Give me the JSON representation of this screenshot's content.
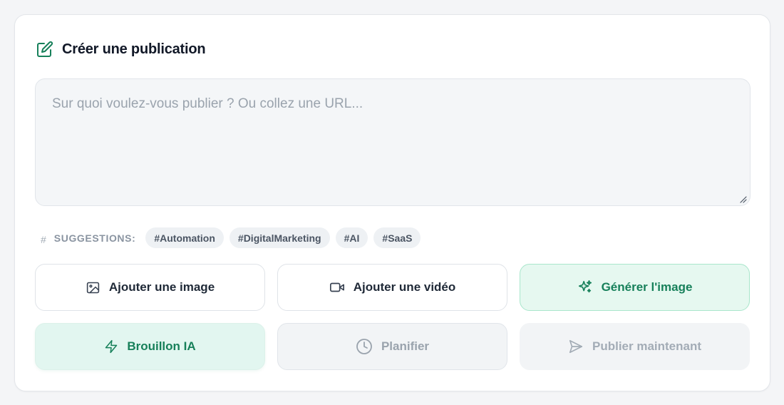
{
  "header": {
    "title": "Créer une publication",
    "icon": "edit-icon"
  },
  "composer": {
    "placeholder": "Sur quoi voulez-vous publier ? Ou collez une URL...",
    "value": ""
  },
  "suggestions": {
    "label": "SUGGESTIONS:",
    "tags": [
      "#Automation",
      "#DigitalMarketing",
      "#AI",
      "#SaaS"
    ]
  },
  "actions": {
    "add_image": {
      "label": "Ajouter une image",
      "icon": "image-icon"
    },
    "add_video": {
      "label": "Ajouter une vidéo",
      "icon": "video-icon"
    },
    "generate_image": {
      "label": "Générer l'image",
      "icon": "sparkles-icon"
    },
    "ai_draft": {
      "label": "Brouillon IA",
      "icon": "lightning-icon"
    },
    "schedule": {
      "label": "Planifier",
      "icon": "clock-icon"
    },
    "publish_now": {
      "label": "Publier maintenant",
      "icon": "send-icon"
    }
  },
  "colors": {
    "accent": "#17805a",
    "text": "#111827",
    "muted": "#9aa3ad",
    "card_bg": "#ffffff",
    "page_bg": "#f4f5f7"
  }
}
